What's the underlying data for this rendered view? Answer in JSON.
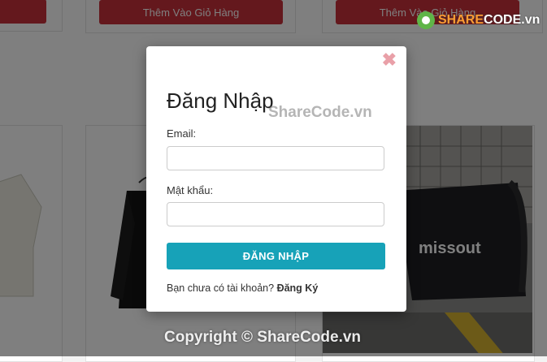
{
  "background": {
    "add_to_cart_label": "Thêm Vào Giỏ Hàng",
    "bag_text": "missout"
  },
  "modal": {
    "close_symbol": "✖",
    "title": "Đăng Nhập",
    "email_label": "Email:",
    "password_label": "Mật khẩu:",
    "login_button": "ĐĂNG NHẬP",
    "no_account_text": "Bạn chưa có tài khoản?",
    "register_link": "Đăng Ký"
  },
  "watermark": {
    "logo_prefix": "SHARE",
    "logo_suffix": "CODE.vn",
    "center": "ShareCode.vn",
    "footer": "Copyright © ShareCode.vn"
  },
  "colors": {
    "primary_button": "#17a2b8",
    "cart_button": "#c8303b",
    "close_icon": "#e9a0a8"
  }
}
